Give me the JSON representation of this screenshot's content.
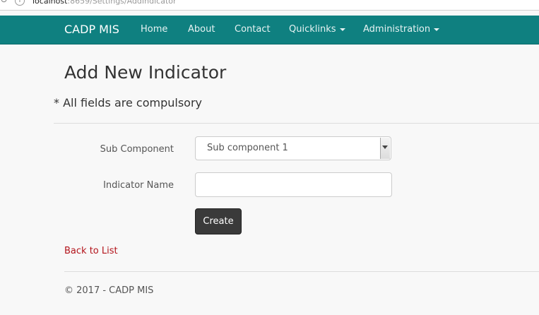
{
  "browser": {
    "url_host": "localhost",
    "url_rest": ":8659/Settings/AddIndicator",
    "nav_icon": "arrow-icon",
    "info_icon": "info-icon"
  },
  "navbar": {
    "brand": "CADP MIS",
    "background": "#0f8080",
    "items": [
      {
        "label": "Home",
        "dropdown": false
      },
      {
        "label": "About",
        "dropdown": false
      },
      {
        "label": "Contact",
        "dropdown": false
      },
      {
        "label": "Quicklinks",
        "dropdown": true
      },
      {
        "label": "Administration",
        "dropdown": true
      }
    ]
  },
  "page": {
    "title": "Add New Indicator",
    "subtitle": "* All fields are compulsory"
  },
  "form": {
    "sub_component": {
      "label": "Sub Component",
      "selected": "Sub component 1"
    },
    "indicator_name": {
      "label": "Indicator Name",
      "value": "",
      "placeholder": ""
    },
    "create_label": "Create"
  },
  "links": {
    "back_to_list": "Back to List",
    "link_color": "#b3141b"
  },
  "footer": {
    "text": "© 2017 - CADP MIS"
  }
}
